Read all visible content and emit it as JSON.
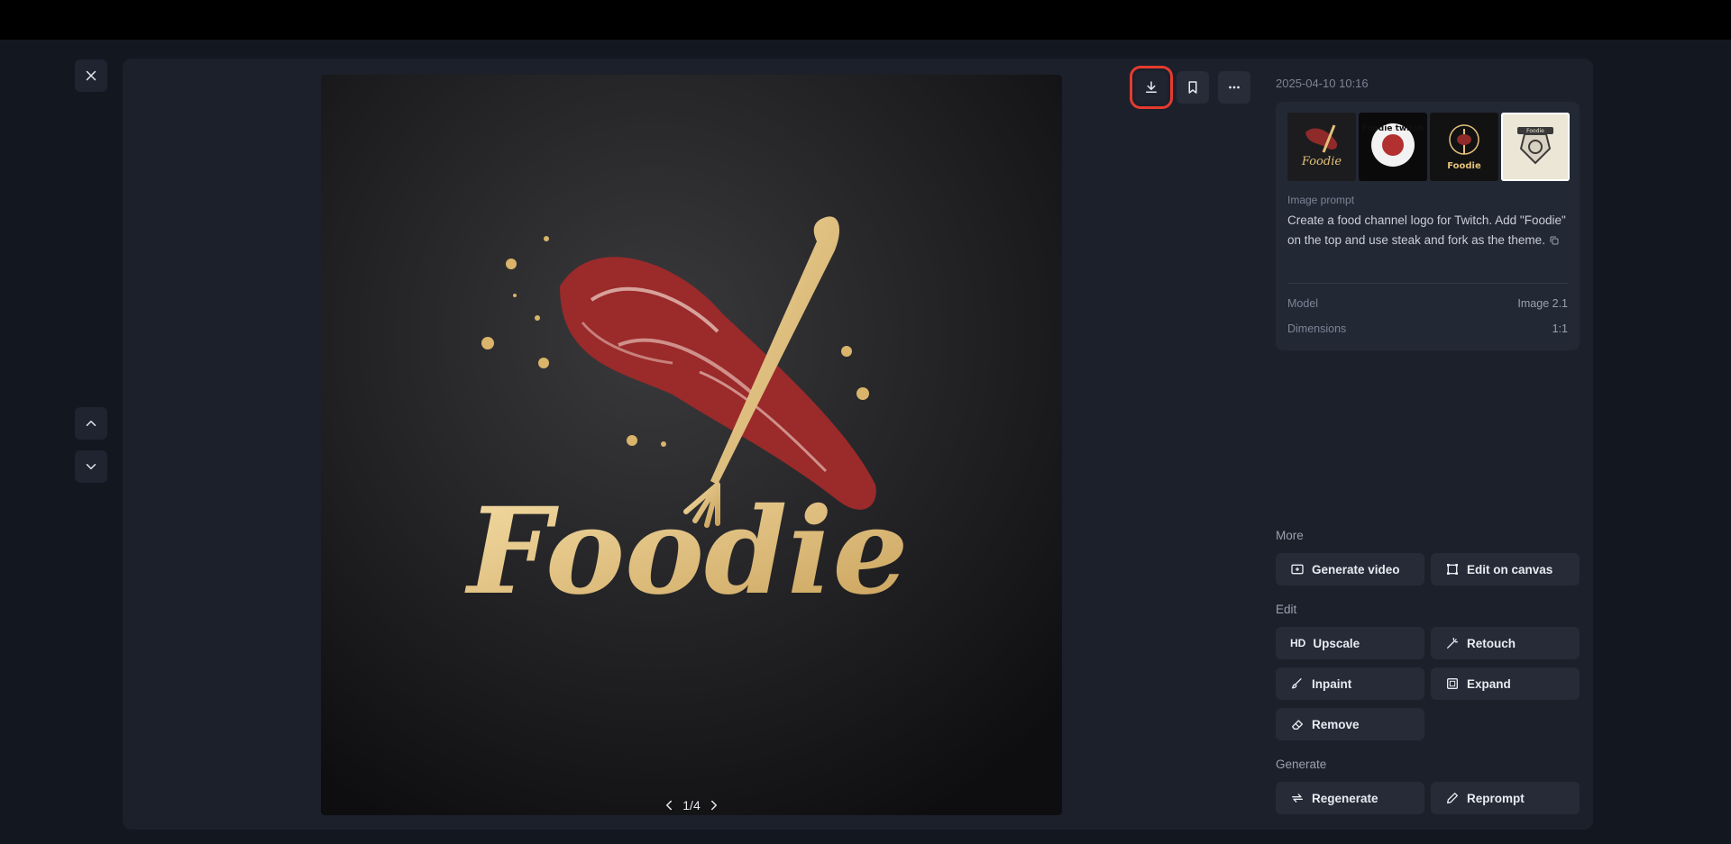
{
  "viewer": {
    "pager": "1/4",
    "timestamp": "2025-04-10 10:16",
    "image_alt_text": "Foodie"
  },
  "info": {
    "prompt_label": "Image prompt",
    "prompt_text": "Create a food channel logo for Twitch. Add \"Foodie\" on the top and use steak and fork as the theme.",
    "model_label": "Model",
    "model_value": "Image 2.1",
    "dimensions_label": "Dimensions",
    "dimensions_value": "1:1",
    "thumbnails": [
      {
        "caption": "Foodie"
      },
      {
        "caption": "Foodie twitch"
      },
      {
        "caption": "Foodie"
      },
      {
        "caption": "Foodie"
      }
    ]
  },
  "sections": {
    "more": "More",
    "edit": "Edit",
    "generate": "Generate"
  },
  "actions": {
    "generate_video": "Generate video",
    "edit_on_canvas": "Edit on canvas",
    "upscale_badge": "HD",
    "upscale": "Upscale",
    "retouch": "Retouch",
    "inpaint": "Inpaint",
    "expand": "Expand",
    "remove": "Remove",
    "regenerate": "Regenerate",
    "reprompt": "Reprompt"
  },
  "icons": {
    "close": "close-icon",
    "up": "chevron-up-icon",
    "down": "chevron-down-icon",
    "download": "download-icon",
    "bookmark": "bookmark-icon",
    "more": "more-horizontal-icon"
  },
  "colors": {
    "highlight": "#e63b2e",
    "gold": "#e3c07a",
    "steak": "#9b2a2a"
  }
}
